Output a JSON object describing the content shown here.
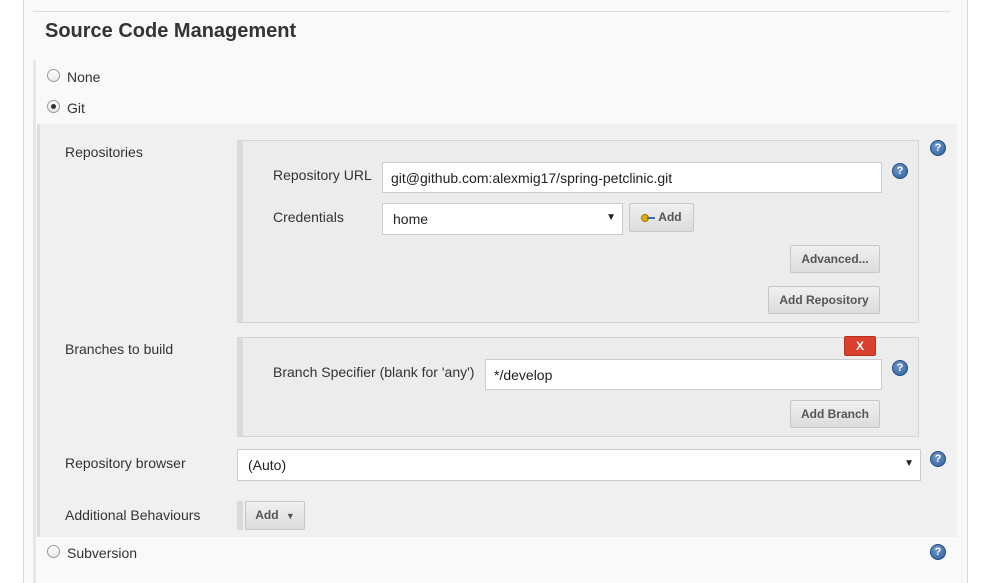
{
  "section": {
    "title": "Source Code Management"
  },
  "scm_options": [
    {
      "label": "None",
      "selected": false
    },
    {
      "label": "Git",
      "selected": true
    },
    {
      "label": "Subversion",
      "selected": false
    }
  ],
  "git": {
    "repositories": {
      "label": "Repositories",
      "url_label": "Repository URL",
      "url_value": "git@github.com:alexmig17/spring-petclinic.git",
      "credentials_label": "Credentials",
      "credentials_value": "home",
      "add_credentials_label": "Add",
      "advanced_label": "Advanced...",
      "add_repository_label": "Add Repository"
    },
    "branches": {
      "label": "Branches to build",
      "delete_label": "X",
      "specifier_label": "Branch Specifier (blank for 'any')",
      "specifier_value": "*/develop",
      "add_branch_label": "Add Branch"
    },
    "repository_browser": {
      "label": "Repository browser",
      "value": "(Auto)"
    },
    "additional_behaviours": {
      "label": "Additional Behaviours",
      "add_label": "Add"
    }
  },
  "help_glyph": "?",
  "colors": {
    "delete_button": "#d9402e",
    "help_icon": "#2d5f9e",
    "panel_bg": "#f0f0f0"
  }
}
